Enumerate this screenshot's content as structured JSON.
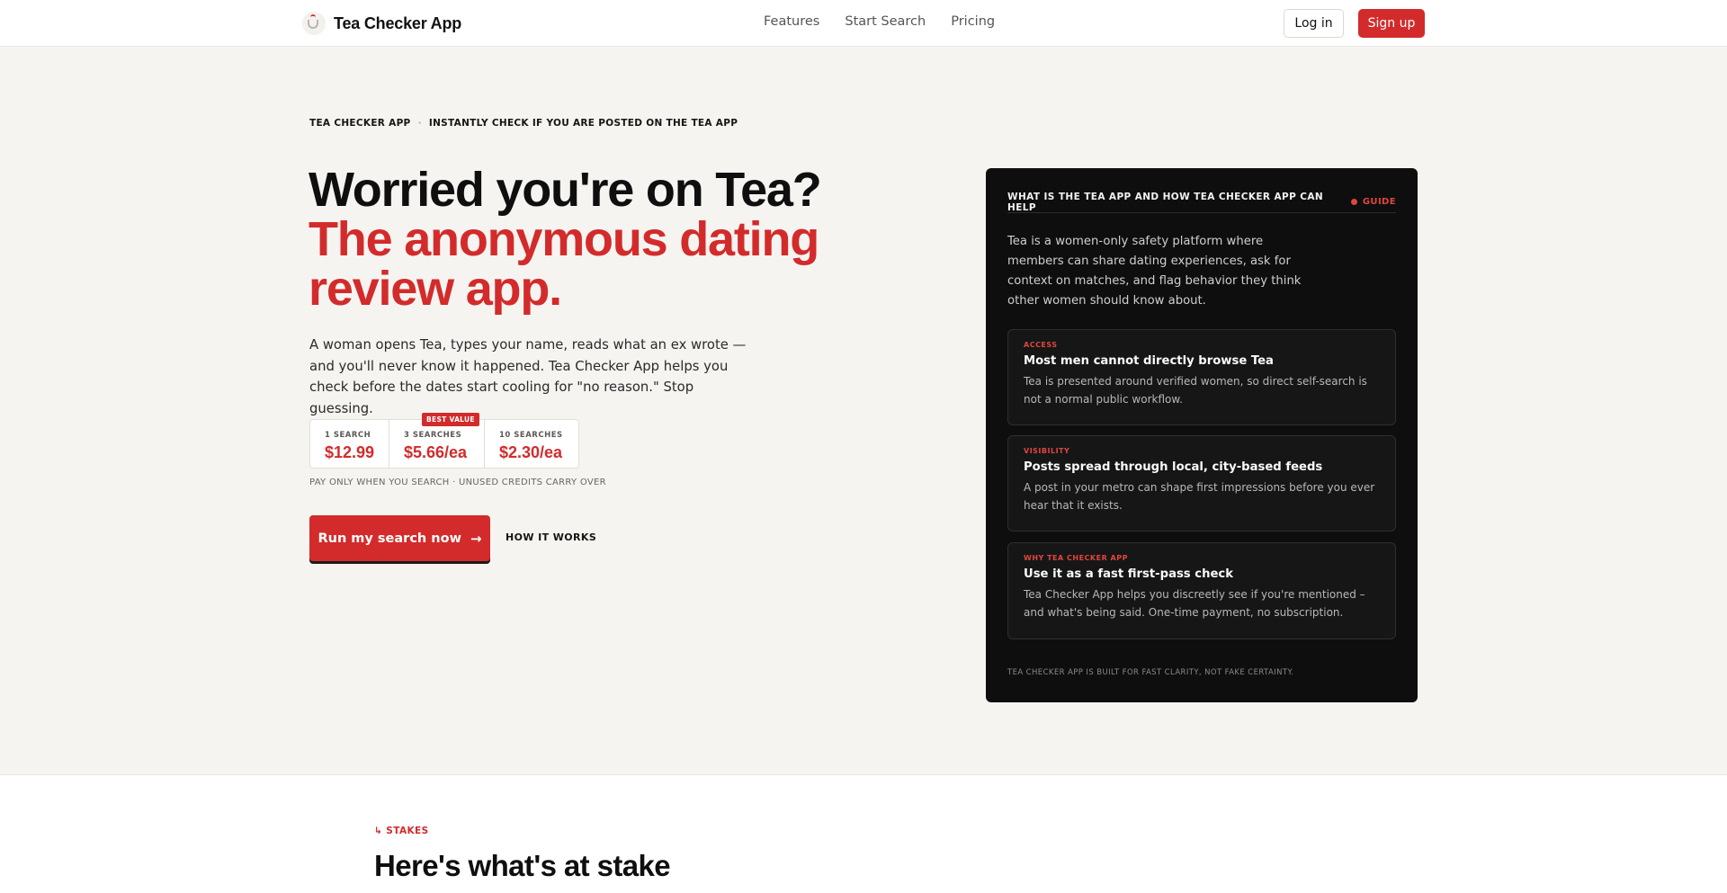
{
  "nav": {
    "brand": "Tea Checker App",
    "links": [
      "Features",
      "Start Search",
      "Pricing"
    ],
    "login": "Log in",
    "signup": "Sign up"
  },
  "hero": {
    "eyebrow_left": "TEA CHECKER APP",
    "eyebrow_sep": "·",
    "eyebrow_right": "INSTANTLY CHECK IF YOU ARE POSTED ON THE TEA APP",
    "headline_1": "Worried you're on Tea?",
    "headline_2": "The anonymous dating review app.",
    "lede": "A woman opens Tea, types your name, reads what an ex wrote — and you'll never know it happened. Tea Checker App helps you check before the dates start cooling for \"no reason.\" Stop guessing.",
    "pricing": [
      {
        "label": "1 SEARCH",
        "price": "$12.99"
      },
      {
        "label": "3 SEARCHES",
        "price": "$5.66/ea",
        "badge": "BEST VALUE"
      },
      {
        "label": "10 SEARCHES",
        "price": "$2.30/ea"
      }
    ],
    "price_note": "PAY ONLY WHEN YOU SEARCH · UNUSED CREDITS CARRY OVER",
    "cta": "Run my search now",
    "cta_arrow": "→",
    "secondary": "HOW IT WORKS"
  },
  "card": {
    "title": "WHAT IS THE TEA APP AND HOW TEA CHECKER APP CAN HELP",
    "guide": "GUIDE",
    "intro": "Tea is a women-only safety platform where members can share dating experiences, ask for context on matches, and flag behavior they think other women should know about.",
    "items": [
      {
        "tag": "ACCESS",
        "title": "Most men cannot directly browse Tea",
        "body": "Tea is presented around verified women, so direct self-search is not a normal public workflow."
      },
      {
        "tag": "VISIBILITY",
        "title": "Posts spread through local, city-based feeds",
        "body": "A post in your metro can shape first impressions before you ever hear that it exists."
      },
      {
        "tag": "WHY TEA CHECKER APP",
        "title": "Use it as a fast first-pass check",
        "body": "Tea Checker App helps you discreetly see if you're mentioned – and what's being said. One-time payment, no subscription."
      }
    ],
    "footer": "TEA CHECKER APP IS BUILT FOR FAST CLARITY, NOT FAKE CERTAINTY."
  },
  "section2": {
    "eyebrow": "↳ STAKES",
    "title": "Here's what's at stake"
  },
  "colors": {
    "accent": "#d32b2b",
    "background": "#f5f4f1",
    "card_bg": "#0e0e0e"
  },
  "icons": {
    "brand": "tea-cup-icon",
    "cta": "arrow-right-icon",
    "guide": "red-dot-icon"
  }
}
